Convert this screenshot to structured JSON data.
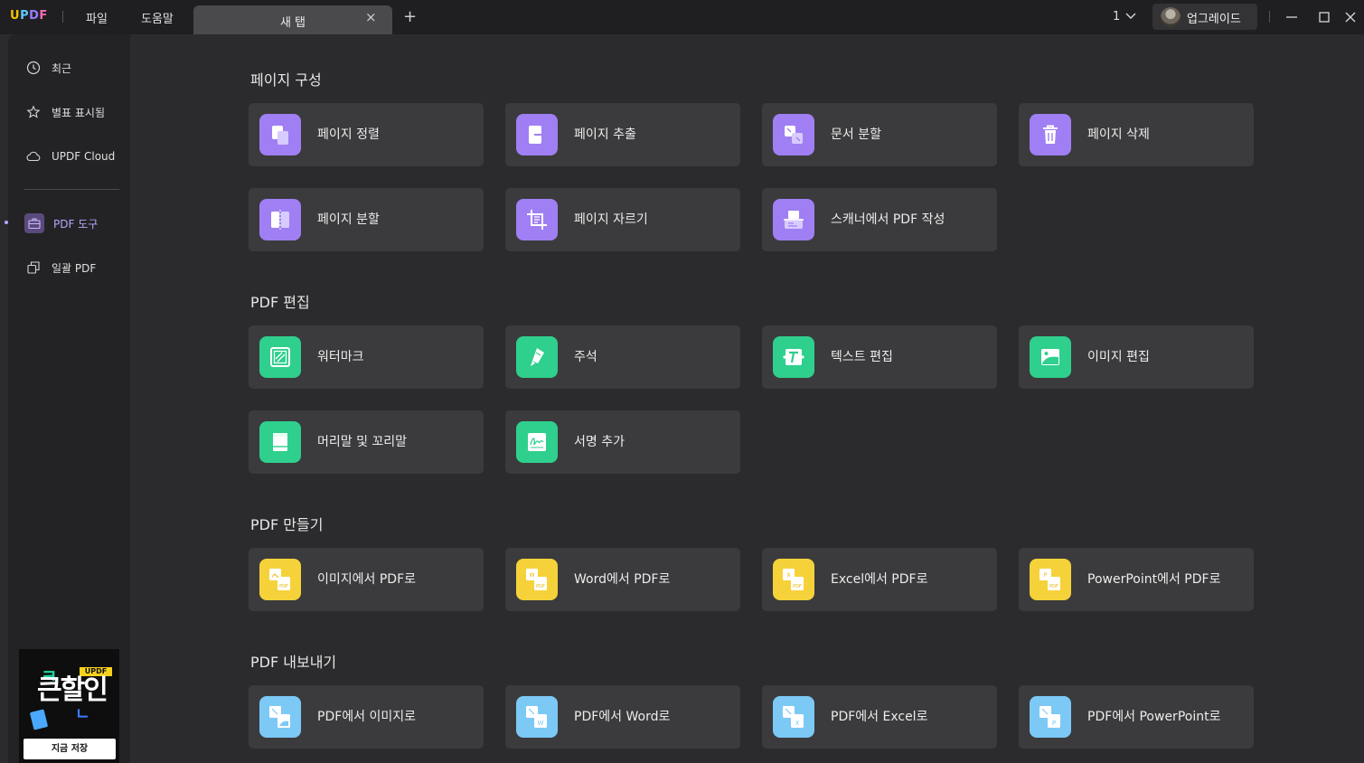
{
  "titlebar": {
    "logo": {
      "u": "U",
      "p": "P",
      "d": "D",
      "f": "F"
    },
    "menu": [
      {
        "label": "파일"
      },
      {
        "label": "도움말"
      }
    ],
    "tab_label": "새 탭",
    "tab_close": "×",
    "tab_add": "+",
    "window_count": "1",
    "upgrade_label": "업그레이드"
  },
  "sidebar": {
    "items": [
      {
        "label": "최근",
        "icon": "clock-icon"
      },
      {
        "label": "별표 표시됨",
        "icon": "star-icon"
      },
      {
        "label": "UPDF Cloud",
        "icon": "cloud-icon"
      },
      {
        "label": "PDF 도구",
        "icon": "briefcase-icon"
      },
      {
        "label": "일괄 PDF",
        "icon": "batch-icon"
      }
    ],
    "active": "PDF 도구",
    "promo": {
      "badge": "UPDF",
      "headline": "큰할인",
      "cta": "지금 저장"
    }
  },
  "sections": [
    {
      "title": "페이지 구성",
      "color": "#9f7ff3",
      "cards": [
        {
          "label": "페이지 정렬",
          "icon": "page-organize-icon"
        },
        {
          "label": "페이지 추출",
          "icon": "page-extract-icon"
        },
        {
          "label": "문서 분할",
          "icon": "document-split-icon"
        },
        {
          "label": "페이지 삭제",
          "icon": "trash-icon"
        },
        {
          "label": "페이지 분할",
          "icon": "page-split-icon"
        },
        {
          "label": "페이지 자르기",
          "icon": "page-crop-icon"
        },
        {
          "label": "스캐너에서 PDF 작성",
          "icon": "scanner-icon"
        }
      ]
    },
    {
      "title": "PDF 편집",
      "color": "#2fcf8d",
      "cards": [
        {
          "label": "워터마크",
          "icon": "watermark-icon"
        },
        {
          "label": "주석",
          "icon": "highlighter-icon"
        },
        {
          "label": "텍스트 편집",
          "icon": "text-edit-icon"
        },
        {
          "label": "이미지 편집",
          "icon": "image-edit-icon"
        },
        {
          "label": "머리말 및 꼬리말",
          "icon": "header-footer-icon"
        },
        {
          "label": "서명 추가",
          "icon": "signature-icon"
        }
      ]
    },
    {
      "title": "PDF 만들기",
      "color": "#f6d23a",
      "cards": [
        {
          "label": "이미지에서 PDF로",
          "icon": "image-to-pdf-icon"
        },
        {
          "label": "Word에서 PDF로",
          "icon": "word-to-pdf-icon"
        },
        {
          "label": "Excel에서 PDF로",
          "icon": "excel-to-pdf-icon"
        },
        {
          "label": "PowerPoint에서 PDF로",
          "icon": "powerpoint-to-pdf-icon"
        }
      ]
    },
    {
      "title": "PDF 내보내기",
      "color": "#7cc9f6",
      "cards": [
        {
          "label": "PDF에서 이미지로",
          "icon": "pdf-to-image-icon"
        },
        {
          "label": "PDF에서 Word로",
          "icon": "pdf-to-word-icon"
        },
        {
          "label": "PDF에서 Excel로",
          "icon": "pdf-to-excel-icon"
        },
        {
          "label": "PDF에서 PowerPoint로",
          "icon": "pdf-to-powerpoint-icon"
        }
      ]
    }
  ]
}
